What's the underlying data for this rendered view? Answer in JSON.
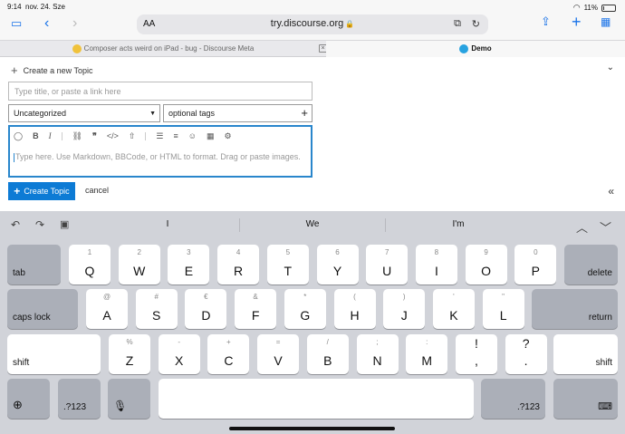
{
  "status": {
    "time": "9:14",
    "date": "nov. 24. Sze",
    "battery": "11%"
  },
  "safari": {
    "url": "try.discourse.org",
    "aa": "AA",
    "icons": {
      "sidebar": "sidebar-icon",
      "back": "back-icon",
      "forward": "forward-icon",
      "share": "share-icon",
      "new_tab": "plus-icon",
      "tabs": "tabs-grid-icon"
    }
  },
  "tabs": [
    {
      "title": "Composer acts weird on iPad - bug - Discourse Meta",
      "active": false
    },
    {
      "title": "Demo",
      "active": true
    }
  ],
  "composer": {
    "create_label": "Create a new Topic",
    "title_placeholder": "Type title, or paste a link here",
    "category": "Uncategorized",
    "tags_placeholder": "optional tags",
    "editor_placeholder": "Type here. Use Markdown, BBCode, or HTML to format. Drag or paste images.",
    "toolbar": [
      "speech-bubble-icon",
      "bold-icon",
      "italic-icon",
      "link-icon",
      "quote-icon",
      "code-icon",
      "upload-icon",
      "bullet-list-icon",
      "numbered-list-icon",
      "emoji-icon",
      "calendar-icon",
      "gear-icon"
    ],
    "create_button": "Create Topic",
    "cancel": "cancel",
    "accent": "#0d7bd5"
  },
  "keyboard": {
    "predictions": [
      "I",
      "We",
      "I'm"
    ],
    "row1": [
      {
        "alt": "1",
        "key": "Q"
      },
      {
        "alt": "2",
        "key": "W"
      },
      {
        "alt": "3",
        "key": "E"
      },
      {
        "alt": "4",
        "key": "R"
      },
      {
        "alt": "5",
        "key": "T"
      },
      {
        "alt": "6",
        "key": "Y"
      },
      {
        "alt": "7",
        "key": "U"
      },
      {
        "alt": "8",
        "key": "I"
      },
      {
        "alt": "9",
        "key": "O"
      },
      {
        "alt": "0",
        "key": "P"
      }
    ],
    "row2": [
      {
        "alt": "@",
        "key": "A"
      },
      {
        "alt": "#",
        "key": "S"
      },
      {
        "alt": "€",
        "key": "D"
      },
      {
        "alt": "&",
        "key": "F"
      },
      {
        "alt": "*",
        "key": "G"
      },
      {
        "alt": "(",
        "key": "H"
      },
      {
        "alt": ")",
        "key": "J"
      },
      {
        "alt": "'",
        "key": "K"
      },
      {
        "alt": "\"",
        "key": "L"
      }
    ],
    "row3": [
      {
        "alt": "%",
        "key": "Z"
      },
      {
        "alt": "-",
        "key": "X"
      },
      {
        "alt": "+",
        "key": "C"
      },
      {
        "alt": "=",
        "key": "V"
      },
      {
        "alt": "/",
        "key": "B"
      },
      {
        "alt": ";",
        "key": "N"
      },
      {
        "alt": ":",
        "key": "M"
      },
      {
        "alt": "!",
        "key": ","
      },
      {
        "alt": "?",
        "key": "."
      }
    ],
    "tab": "tab",
    "delete": "delete",
    "caps": "caps lock",
    "return": "return",
    "shift": "shift",
    "num": ".?123"
  }
}
